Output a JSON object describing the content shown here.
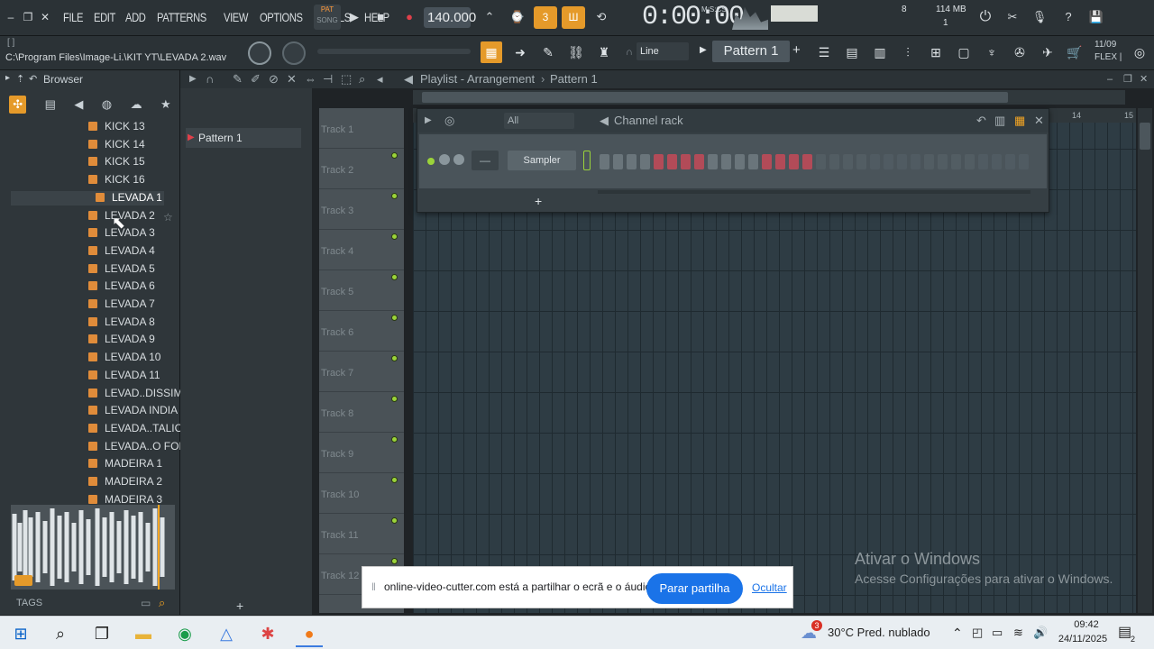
{
  "menu": [
    "FILE",
    "EDIT",
    "ADD",
    "PATTERNS",
    "VIEW",
    "OPTIONS",
    "TOOLS",
    "HELP"
  ],
  "transport": {
    "pat_label": "PAT",
    "song_label": "SONG",
    "tempo": "140.000",
    "time": "0:00:00",
    "time_unit": "M:S:CS"
  },
  "meters": {
    "poly": "8",
    "mem": "114 MB",
    "cpu": "1"
  },
  "hint_path": "C:\\Program Files\\Image-Li.\\KIT YT\\LEVADA 2.wav",
  "snap": "Line",
  "pattern_selector": "Pattern 1",
  "flex": {
    "date": "11/09",
    "label": "FLEX |"
  },
  "browser": {
    "title": "Browser",
    "items": [
      "KICK 13",
      "KICK 14",
      "KICK 15",
      "KICK 16",
      "LEVADA 1",
      "LEVADA 2",
      "LEVADA 3",
      "LEVADA 4",
      "LEVADA 5",
      "LEVADA 6",
      "LEVADA 7",
      "LEVADA 8",
      "LEVADA 9",
      "LEVADA 10",
      "LEVADA 11",
      "LEVAD..DISSIMA",
      "LEVADA INDIA",
      "LEVADA..TALICOS",
      "LEVADA..O FODA",
      "MADEIRA 1",
      "MADEIRA 2",
      "MADEIRA 3"
    ],
    "tags_label": "TAGS"
  },
  "playlist": {
    "title": "Playlist - Arrangement",
    "crumb": "Pattern 1",
    "pattern_item": "Pattern 1",
    "tracks": [
      "Track 1",
      "Track 2",
      "Track 3",
      "Track 4",
      "Track 5",
      "Track 6",
      "Track 7",
      "Track 8",
      "Track 9",
      "Track 10",
      "Track 11",
      "Track 12"
    ],
    "ruler": [
      "14",
      "15"
    ]
  },
  "channel_rack": {
    "title": "Channel rack",
    "filter": "All",
    "channel": "Sampler",
    "plus": "+"
  },
  "notification": {
    "message": "online-video-cutter.com está a partilhar o ecrã e o áudio.",
    "stop_label": "Parar partilha",
    "hide_label": "Ocultar"
  },
  "watermark": {
    "line1": "Ativar o Windows",
    "line2": "Acesse Configurações para ativar o Windows."
  },
  "taskbar": {
    "weather": "30°C  Pred. nublado",
    "time": "09:42",
    "date": "24/11/2025",
    "badge": "3",
    "notif_count": "2"
  },
  "colors": {
    "accent": "#f5a623",
    "green_led": "#9bd33a",
    "step_red": "#b24b58",
    "step_gray": "#6a757b"
  }
}
